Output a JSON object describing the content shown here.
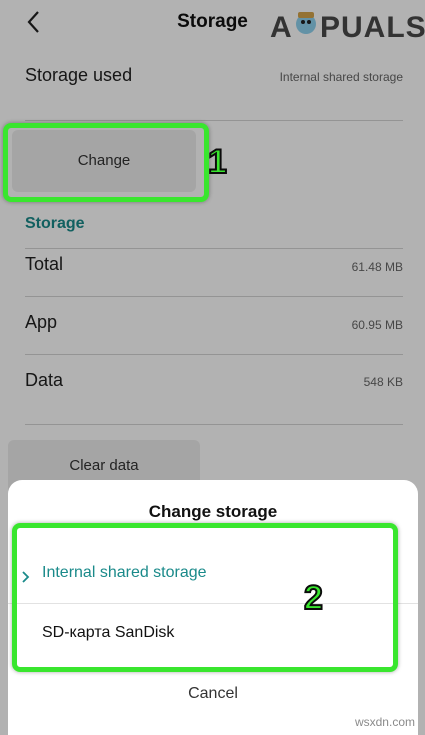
{
  "header": {
    "title": "Storage",
    "back_icon": "chevron-left-icon",
    "logo_text": "A  PUALS"
  },
  "storage_used": {
    "label": "Storage used",
    "value": "Internal shared storage"
  },
  "change_button": {
    "label": "Change"
  },
  "section": {
    "title": "Storage"
  },
  "rows": [
    {
      "label": "Total",
      "value": "61.48 MB"
    },
    {
      "label": "App",
      "value": "60.95 MB"
    },
    {
      "label": "Data",
      "value": "548 KB"
    }
  ],
  "clear_button": {
    "label": "Clear data"
  },
  "sheet": {
    "title": "Change storage",
    "options": [
      {
        "label": "Internal shared storage",
        "selected": true
      },
      {
        "label": "SD-карта SanDisk",
        "selected": false
      }
    ],
    "cancel_label": "Cancel"
  },
  "annotations": [
    {
      "number": "1"
    },
    {
      "number": "2"
    }
  ],
  "watermark": "wsxdn.com",
  "colors": {
    "accent": "#1a8a8a",
    "highlight": "#39e62e"
  }
}
